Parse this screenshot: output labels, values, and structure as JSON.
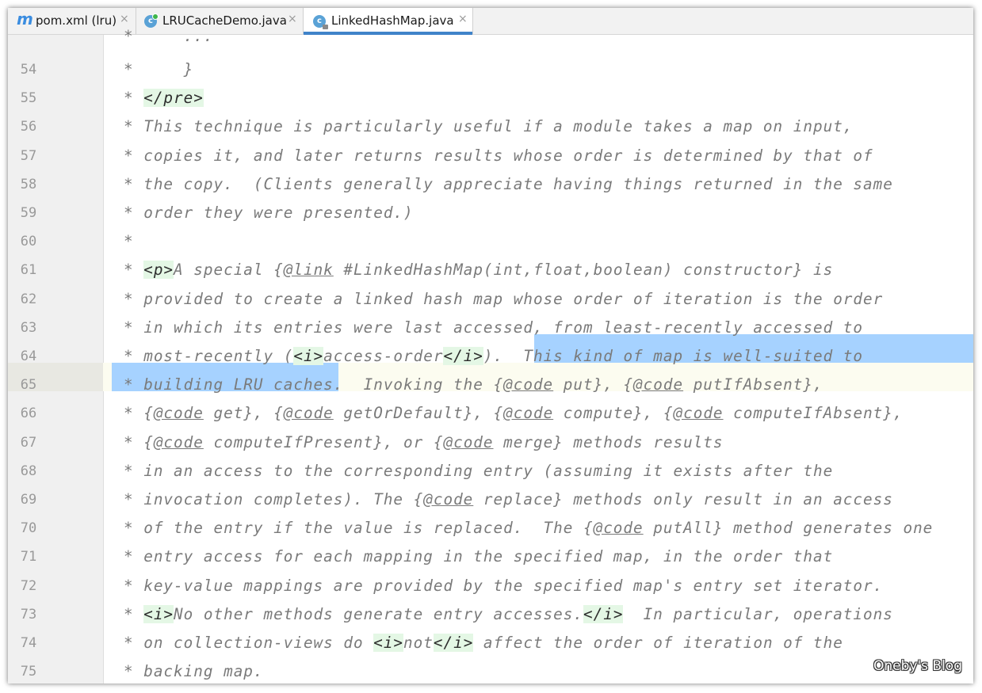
{
  "tabs": [
    {
      "label": "pom.xml (lru)",
      "icon": "maven-icon",
      "active": false
    },
    {
      "label": "LRUCacheDemo.java",
      "icon": "java-class-icon",
      "active": false
    },
    {
      "label": "LinkedHashMap.java",
      "icon": "java-class-icon",
      "active": true
    }
  ],
  "close_glyph": "×",
  "maven_glyph": "m",
  "class_glyph": "c",
  "colors": {
    "selection": "#a6d2ff",
    "tag_bg": "#e4f7e5",
    "active_tab_underline": "#4083c9",
    "comment": "#7a7a7a"
  },
  "editor": {
    "partial_top_line": "*     ...",
    "lines": [
      {
        "num": "54",
        "parts": [
          {
            "t": "*     }"
          }
        ]
      },
      {
        "num": "55",
        "parts": [
          {
            "t": "* "
          },
          {
            "t": "</pre>",
            "k": "tag"
          }
        ]
      },
      {
        "num": "56",
        "parts": [
          {
            "t": "* This technique is particularly useful if a module takes a map on input,"
          }
        ]
      },
      {
        "num": "57",
        "parts": [
          {
            "t": "* copies it, and later returns results whose order is determined by that of"
          }
        ]
      },
      {
        "num": "58",
        "parts": [
          {
            "t": "* the copy.  (Clients generally appreciate having things returned in the same"
          }
        ]
      },
      {
        "num": "59",
        "parts": [
          {
            "t": "* order they were presented.)"
          }
        ]
      },
      {
        "num": "60",
        "parts": [
          {
            "t": "*"
          }
        ]
      },
      {
        "num": "61",
        "parts": [
          {
            "t": "* "
          },
          {
            "t": "<p>",
            "k": "tag"
          },
          {
            "t": "A special {"
          },
          {
            "t": "@link",
            "k": "at"
          },
          {
            "t": " #LinkedHashMap(int,float,boolean) constructor} is"
          }
        ]
      },
      {
        "num": "62",
        "parts": [
          {
            "t": "* provided to create a linked hash map whose order of iteration is the order"
          }
        ]
      },
      {
        "num": "63",
        "parts": [
          {
            "t": "* in which its entries were last accessed, from least-recently accessed to"
          }
        ]
      },
      {
        "num": "64",
        "parts": [
          {
            "t": "* most-recently ("
          },
          {
            "t": "<i>",
            "k": "tag"
          },
          {
            "t": "access-order"
          },
          {
            "t": "</i>",
            "k": "tag"
          },
          {
            "t": ").  This kind of map is well-suited to"
          }
        ]
      },
      {
        "num": "65",
        "parts": [
          {
            "t": "* building LRU caches.  Invoking the {"
          },
          {
            "t": "@code",
            "k": "at"
          },
          {
            "t": " put}, {"
          },
          {
            "t": "@code",
            "k": "at"
          },
          {
            "t": " putIfAbsent},"
          }
        ]
      },
      {
        "num": "66",
        "parts": [
          {
            "t": "* {"
          },
          {
            "t": "@code",
            "k": "at"
          },
          {
            "t": " get}, {"
          },
          {
            "t": "@code",
            "k": "at"
          },
          {
            "t": " getOrDefault}, {"
          },
          {
            "t": "@code",
            "k": "at"
          },
          {
            "t": " compute}, {"
          },
          {
            "t": "@code",
            "k": "at"
          },
          {
            "t": " computeIfAbsent},"
          }
        ]
      },
      {
        "num": "67",
        "parts": [
          {
            "t": "* {"
          },
          {
            "t": "@code",
            "k": "at"
          },
          {
            "t": " computeIfPresent}, or {"
          },
          {
            "t": "@code",
            "k": "at"
          },
          {
            "t": " merge} methods results"
          }
        ]
      },
      {
        "num": "68",
        "parts": [
          {
            "t": "* in an access to the corresponding entry (assuming it exists after the"
          }
        ]
      },
      {
        "num": "69",
        "parts": [
          {
            "t": "* invocation completes). The {"
          },
          {
            "t": "@code",
            "k": "at"
          },
          {
            "t": " replace} methods only result in an access"
          }
        ]
      },
      {
        "num": "70",
        "parts": [
          {
            "t": "* of the entry if the value is replaced.  The {"
          },
          {
            "t": "@code",
            "k": "at"
          },
          {
            "t": " putAll} method generates one"
          }
        ]
      },
      {
        "num": "71",
        "parts": [
          {
            "t": "* entry access for each mapping in the specified map, in the order that"
          }
        ]
      },
      {
        "num": "72",
        "parts": [
          {
            "t": "* key-value mappings are provided by the specified map's entry set iterator."
          }
        ]
      },
      {
        "num": "73",
        "parts": [
          {
            "t": "* "
          },
          {
            "t": "<i>",
            "k": "tag"
          },
          {
            "t": "No other methods generate entry accesses."
          },
          {
            "t": "</i>",
            "k": "tag"
          },
          {
            "t": "  In particular, operations"
          }
        ]
      },
      {
        "num": "74",
        "parts": [
          {
            "t": "* on collection-views do "
          },
          {
            "t": "<i>",
            "k": "tag"
          },
          {
            "t": "not"
          },
          {
            "t": "</i>",
            "k": "tag"
          },
          {
            "t": " affect the order of iteration of the"
          }
        ]
      },
      {
        "num": "75",
        "parts": [
          {
            "t": "* backing map."
          }
        ]
      }
    ]
  },
  "watermark": "Oneby's Blog"
}
